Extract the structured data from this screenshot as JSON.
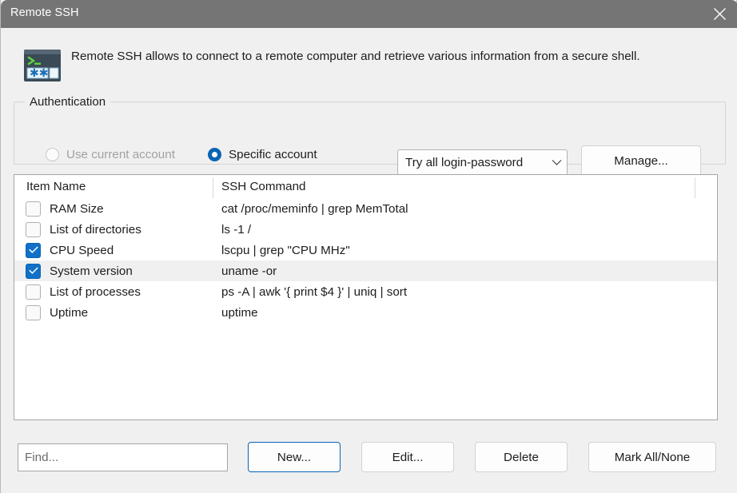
{
  "window": {
    "title": "Remote SSH",
    "close_icon": "close-icon"
  },
  "header": {
    "icon": "terminal-ssh-icon",
    "description": "Remote SSH allows to connect to a remote computer and retrieve various information from a secure shell."
  },
  "authentication": {
    "legend": "Authentication",
    "options": [
      {
        "label": "Use current account",
        "selected": false,
        "disabled": true
      },
      {
        "label": "Specific account",
        "selected": true,
        "disabled": false
      }
    ],
    "login_mode": {
      "value": "Try all login-password",
      "chevron_icon": "chevron-down-icon"
    },
    "manage_label": "Manage..."
  },
  "list": {
    "columns": [
      "Item Name",
      "SSH Command"
    ],
    "rows": [
      {
        "checked": false,
        "selected": false,
        "name": "RAM Size",
        "command": "cat /proc/meminfo | grep MemTotal"
      },
      {
        "checked": false,
        "selected": false,
        "name": "List of directories",
        "command": "ls -1 /"
      },
      {
        "checked": true,
        "selected": false,
        "name": "CPU Speed",
        "command": "lscpu | grep \"CPU MHz\""
      },
      {
        "checked": true,
        "selected": true,
        "name": "System version",
        "command": "uname -or"
      },
      {
        "checked": false,
        "selected": false,
        "name": "List of processes",
        "command": "ps -A | awk '{ print $4 }' | uniq | sort"
      },
      {
        "checked": false,
        "selected": false,
        "name": "Uptime",
        "command": "uptime"
      }
    ]
  },
  "footer": {
    "find_placeholder": "Find...",
    "new_label": "New...",
    "edit_label": "Edit...",
    "delete_label": "Delete",
    "mark_all_label": "Mark All/None"
  },
  "colors": {
    "titlebar": "#757575",
    "dialog_bg": "#f0f0f0",
    "accent": "#0a64b4",
    "checkbox_checked": "#1170c8",
    "selected_row": "#f0f0f0",
    "text": "#1d1d1d",
    "disabled_text": "#a2a2a2"
  }
}
